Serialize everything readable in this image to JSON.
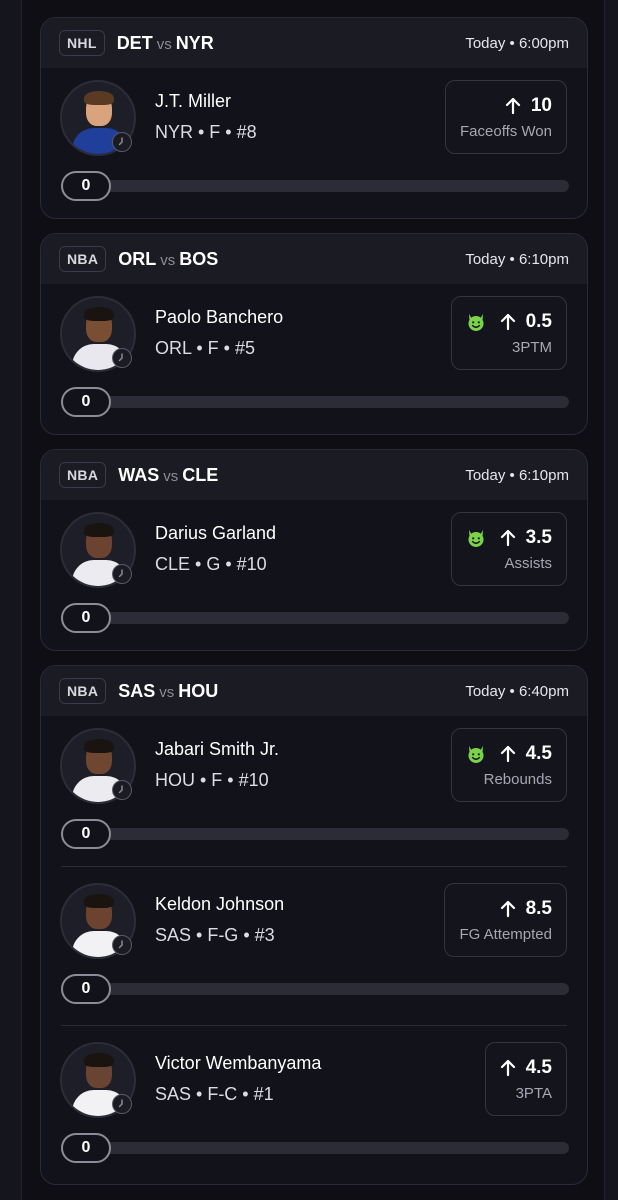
{
  "games": [
    {
      "league": "NHL",
      "home": "DET",
      "vs": "vs",
      "away": "NYR",
      "time": "Today • 6:00pm",
      "players": [
        {
          "name": "J.T. Miller",
          "meta": "NYR • F • #8",
          "direction": "up",
          "line": "10",
          "stat": "Faceoffs Won",
          "promo": false,
          "progress": "0",
          "jersey": "#1f3f9a",
          "skin": "#d9a37e",
          "hair": "#5a3a22"
        }
      ]
    },
    {
      "league": "NBA",
      "home": "ORL",
      "vs": "vs",
      "away": "BOS",
      "time": "Today • 6:10pm",
      "players": [
        {
          "name": "Paolo Banchero",
          "meta": "ORL • F • #5",
          "direction": "up",
          "line": "0.5",
          "stat": "3PTM",
          "promo": true,
          "progress": "0",
          "jersey": "#e8e8ee",
          "skin": "#7a4e33",
          "hair": "#1a1410"
        }
      ]
    },
    {
      "league": "NBA",
      "home": "WAS",
      "vs": "vs",
      "away": "CLE",
      "time": "Today • 6:10pm",
      "players": [
        {
          "name": "Darius Garland",
          "meta": "CLE • G • #10",
          "direction": "up",
          "line": "3.5",
          "stat": "Assists",
          "promo": true,
          "progress": "0",
          "jersey": "#ececf0",
          "skin": "#6b4330",
          "hair": "#1a1410"
        }
      ]
    },
    {
      "league": "NBA",
      "home": "SAS",
      "vs": "vs",
      "away": "HOU",
      "time": "Today • 6:40pm",
      "players": [
        {
          "name": "Jabari Smith Jr.",
          "meta": "HOU • F • #10",
          "direction": "up",
          "line": "4.5",
          "stat": "Rebounds",
          "promo": true,
          "progress": "0",
          "jersey": "#ececf0",
          "skin": "#6e4632",
          "hair": "#1a1410"
        },
        {
          "name": "Keldon Johnson",
          "meta": "SAS • F-G • #3",
          "direction": "up",
          "line": "8.5",
          "stat": "FG Attempted",
          "promo": false,
          "progress": "0",
          "jersey": "#f2f2f4",
          "skin": "#6b4330",
          "hair": "#1a1410"
        },
        {
          "name": "Victor Wembanyama",
          "meta": "SAS • F-C • #1",
          "direction": "up",
          "line": "4.5",
          "stat": "3PTA",
          "promo": false,
          "progress": "0",
          "jersey": "#f2f2f4",
          "skin": "#6a4432",
          "hair": "#1a1410"
        }
      ]
    }
  ],
  "colors": {
    "promo_green": "#7bd34a",
    "arrow": "#ffffff",
    "progress_track": "#2c2c36"
  }
}
